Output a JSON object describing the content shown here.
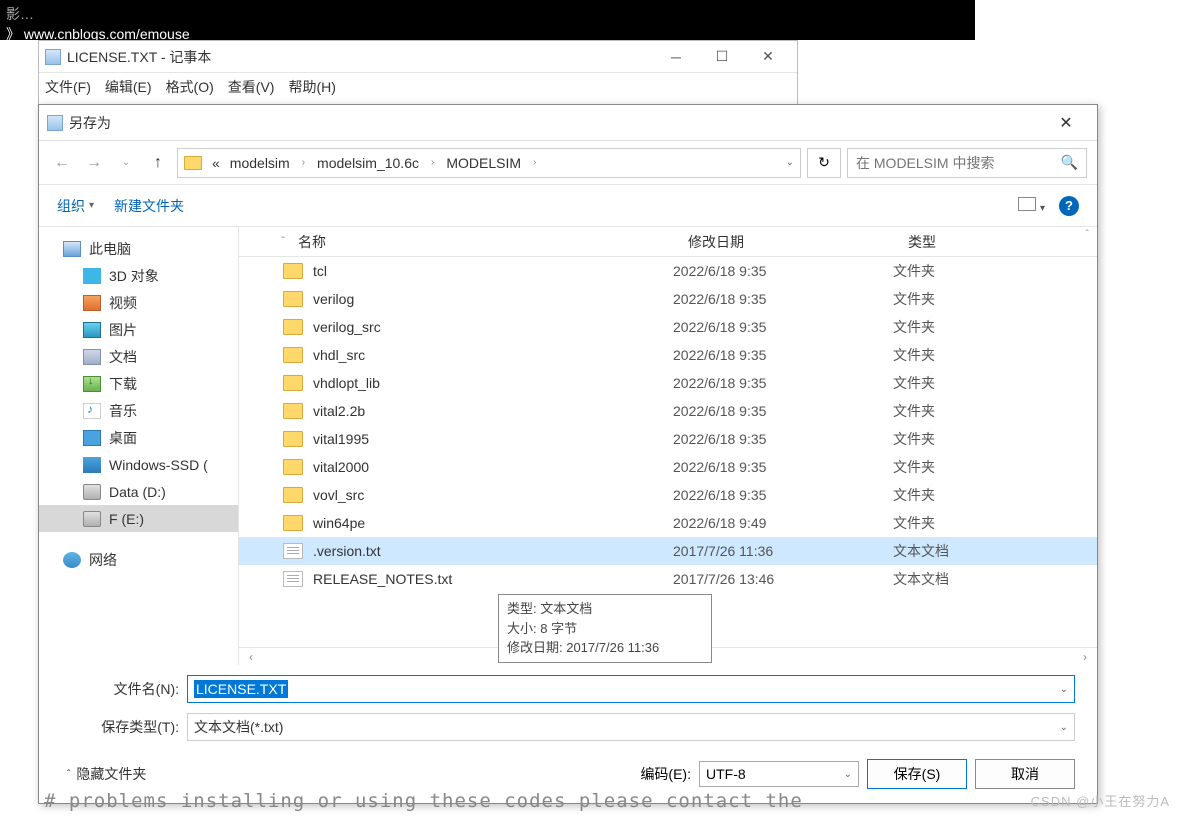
{
  "terminal": {
    "line1": "影…",
    "line2": "》 www.cnblogs.com/emouse"
  },
  "notepad": {
    "title": "LICENSE.TXT - 记事本",
    "menu": [
      "文件(F)",
      "编辑(E)",
      "格式(O)",
      "查看(V)",
      "帮助(H)"
    ]
  },
  "dialog": {
    "title": "另存为",
    "breadcrumb": {
      "prefix": "«",
      "parts": [
        "modelsim",
        "modelsim_10.6c",
        "MODELSIM"
      ]
    },
    "search_placeholder": "在 MODELSIM 中搜索",
    "toolbar": {
      "organize": "组织",
      "new_folder": "新建文件夹"
    },
    "tree": [
      {
        "label": "此电脑",
        "icon": "ic-pc",
        "level": 1
      },
      {
        "label": "3D 对象",
        "icon": "ic-3d",
        "level": 2
      },
      {
        "label": "视频",
        "icon": "ic-vid",
        "level": 2
      },
      {
        "label": "图片",
        "icon": "ic-pic",
        "level": 2
      },
      {
        "label": "文档",
        "icon": "ic-doc",
        "level": 2
      },
      {
        "label": "下载",
        "icon": "ic-dl",
        "level": 2
      },
      {
        "label": "音乐",
        "icon": "ic-mus",
        "level": 2
      },
      {
        "label": "桌面",
        "icon": "ic-desk",
        "level": 2
      },
      {
        "label": "Windows-SSD (",
        "icon": "ic-win",
        "level": 2
      },
      {
        "label": "Data (D:)",
        "icon": "ic-drv",
        "level": 2
      },
      {
        "label": "F (E:)",
        "icon": "ic-drv",
        "level": 2,
        "selected": true
      },
      {
        "label": "网络",
        "icon": "ic-net",
        "level": 1
      }
    ],
    "columns": {
      "name": "名称",
      "date": "修改日期",
      "type": "类型"
    },
    "files": [
      {
        "name": "tcl",
        "date": "2022/6/18 9:35",
        "type": "文件夹",
        "kind": "folder"
      },
      {
        "name": "verilog",
        "date": "2022/6/18 9:35",
        "type": "文件夹",
        "kind": "folder"
      },
      {
        "name": "verilog_src",
        "date": "2022/6/18 9:35",
        "type": "文件夹",
        "kind": "folder"
      },
      {
        "name": "vhdl_src",
        "date": "2022/6/18 9:35",
        "type": "文件夹",
        "kind": "folder"
      },
      {
        "name": "vhdlopt_lib",
        "date": "2022/6/18 9:35",
        "type": "文件夹",
        "kind": "folder"
      },
      {
        "name": "vital2.2b",
        "date": "2022/6/18 9:35",
        "type": "文件夹",
        "kind": "folder"
      },
      {
        "name": "vital1995",
        "date": "2022/6/18 9:35",
        "type": "文件夹",
        "kind": "folder"
      },
      {
        "name": "vital2000",
        "date": "2022/6/18 9:35",
        "type": "文件夹",
        "kind": "folder"
      },
      {
        "name": "vovl_src",
        "date": "2022/6/18 9:35",
        "type": "文件夹",
        "kind": "folder"
      },
      {
        "name": "win64pe",
        "date": "2022/6/18 9:49",
        "type": "文件夹",
        "kind": "folder"
      },
      {
        "name": ".version.txt",
        "date": "2017/7/26 11:36",
        "type": "文本文档",
        "kind": "txt",
        "selected": true
      },
      {
        "name": "RELEASE_NOTES.txt",
        "date": "2017/7/26 13:46",
        "type": "文本文档",
        "kind": "txt"
      }
    ],
    "tooltip": {
      "l1": "类型: 文本文档",
      "l2": "大小: 8 字节",
      "l3": "修改日期: 2017/7/26 11:36"
    },
    "form": {
      "filename_label": "文件名(N):",
      "filename_value": "LICENSE.TXT",
      "filetype_label": "保存类型(T):",
      "filetype_value": "文本文档(*.txt)"
    },
    "footer": {
      "hide_folders": "隐藏文件夹",
      "encoding_label": "编码(E):",
      "encoding_value": "UTF-8",
      "save": "保存(S)",
      "cancel": "取消"
    }
  },
  "bg_text": "# problems   installing or   using   these   codes please   contact the",
  "watermark": "CSDN @小王在努力A"
}
